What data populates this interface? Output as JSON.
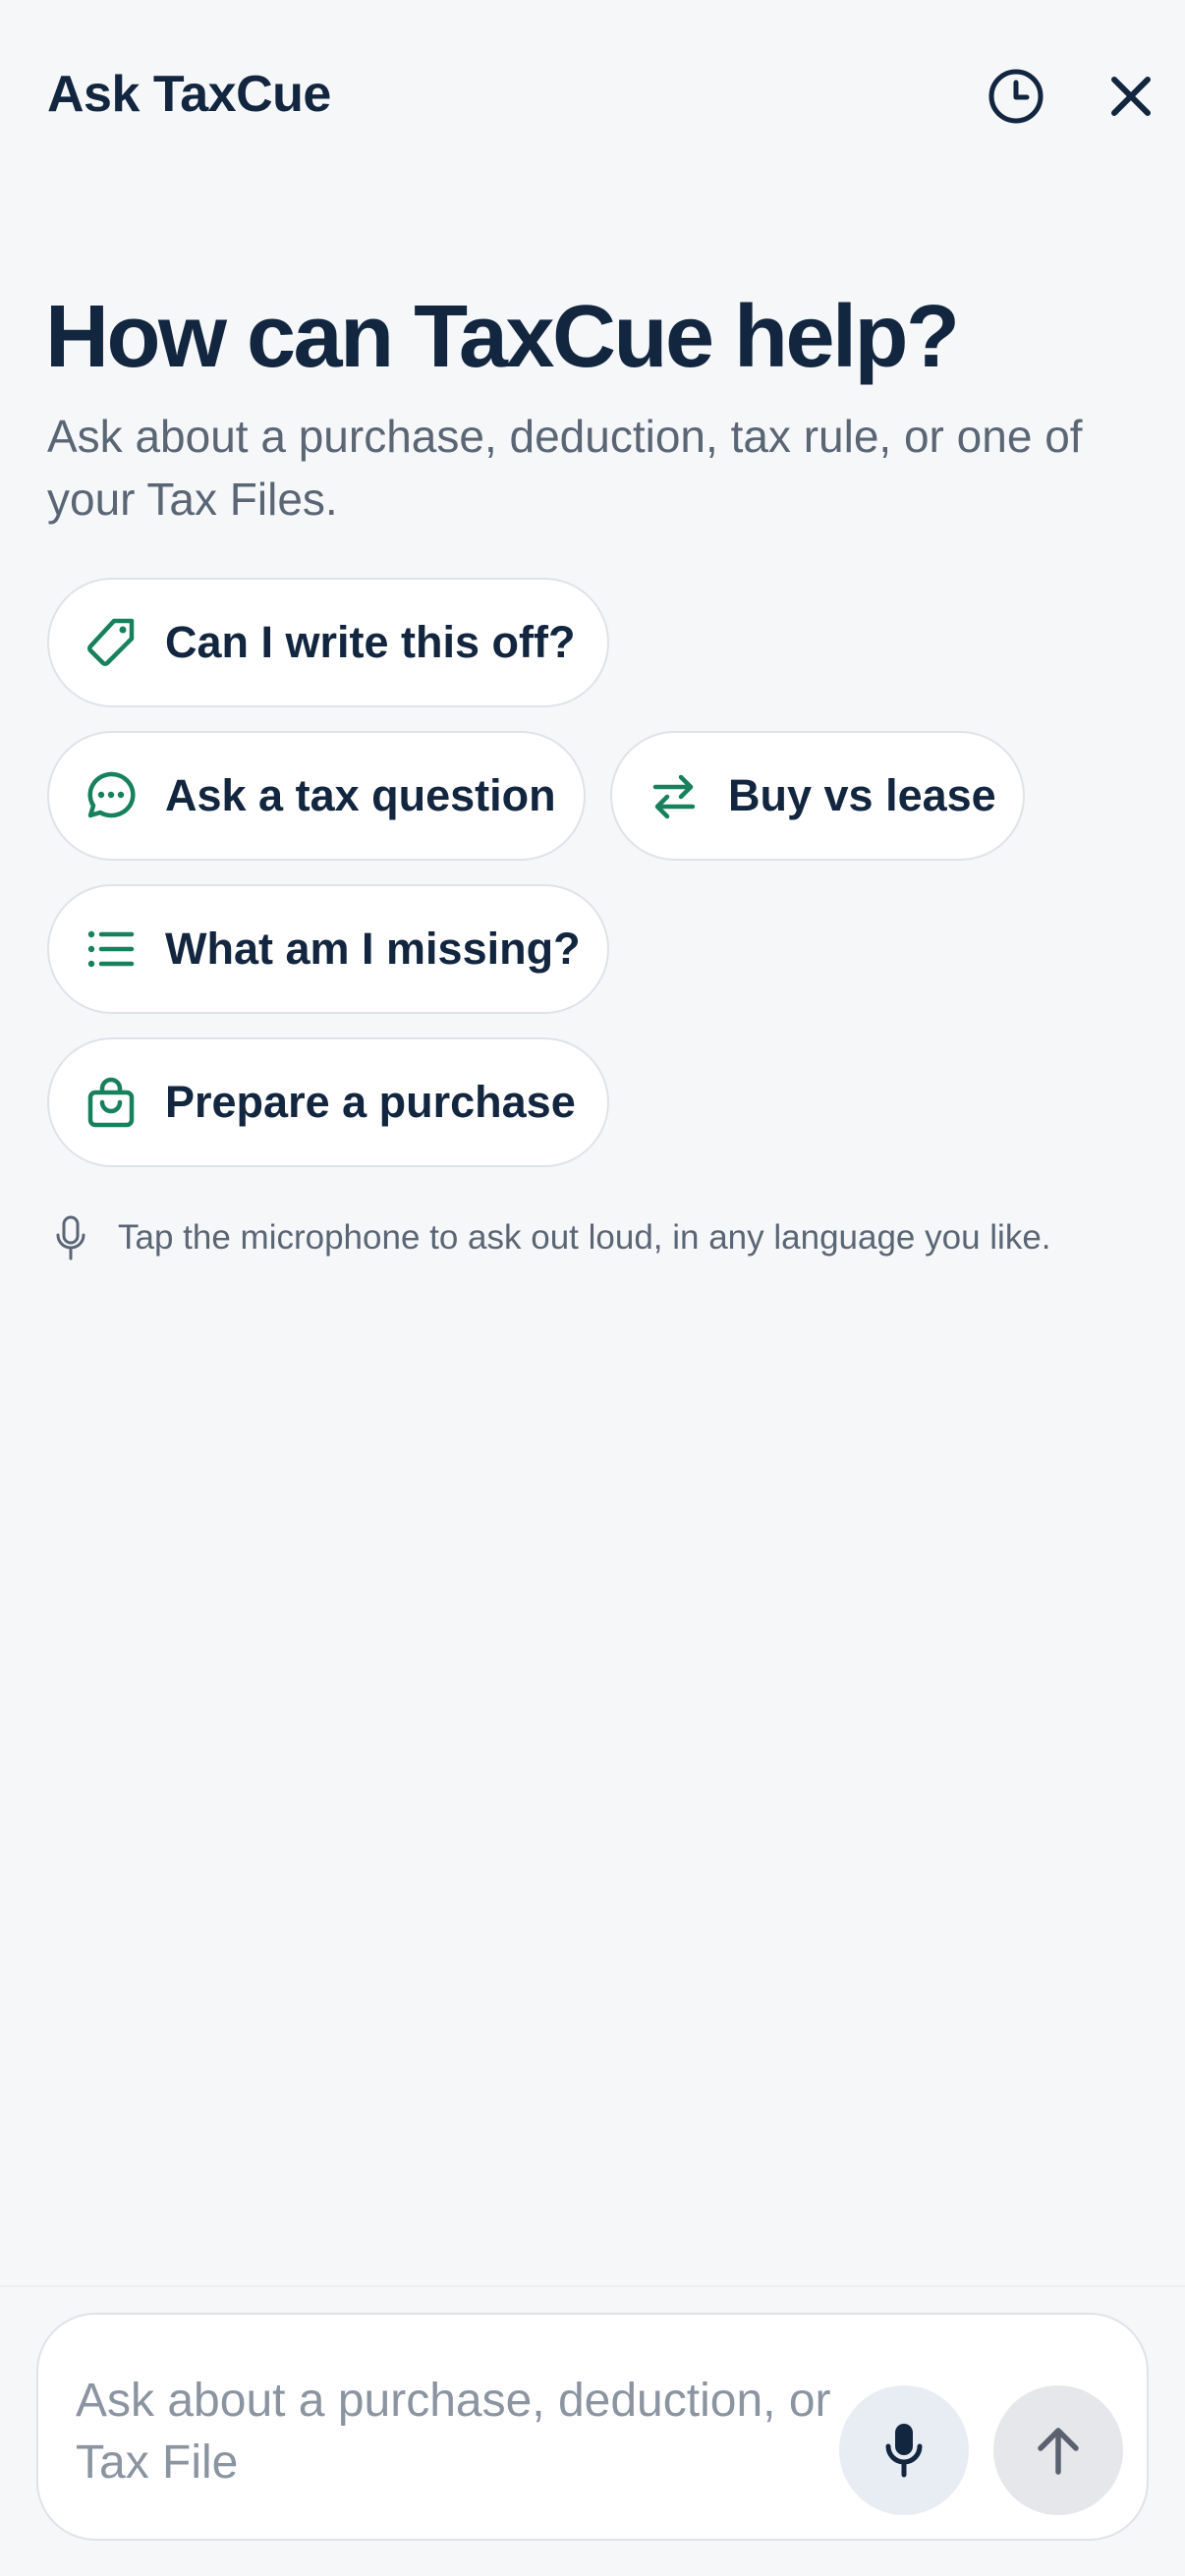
{
  "header": {
    "title": "Ask TaxCue",
    "history_icon": "clock-icon",
    "close_icon": "close-icon"
  },
  "hero": {
    "title": "How can TaxCue help?",
    "subtitle": "Ask about a purchase, deduction, tax rule, or one of your Tax Files."
  },
  "suggestions": [
    {
      "label": "Can I write this off?",
      "icon": "tag-icon"
    },
    {
      "label": "Ask a tax question",
      "icon": "chat-bubble-icon"
    },
    {
      "label": "Buy vs lease",
      "icon": "swap-arrows-icon"
    },
    {
      "label": "What am I missing?",
      "icon": "list-icon"
    },
    {
      "label": "Prepare a purchase",
      "icon": "shopping-bag-icon"
    }
  ],
  "voice_hint": {
    "text": "Tap the microphone to ask out loud, in any language you like.",
    "icon": "microphone-icon"
  },
  "composer": {
    "placeholder": "Ask about a purchase, deduction, or Tax File",
    "mic_icon": "microphone-icon",
    "send_icon": "arrow-up-icon"
  },
  "colors": {
    "background": "#f6f7f9",
    "text_primary": "#12263f",
    "text_secondary": "#5b6675",
    "accent_green": "#17805c",
    "chip_border": "#dfe3e8"
  }
}
